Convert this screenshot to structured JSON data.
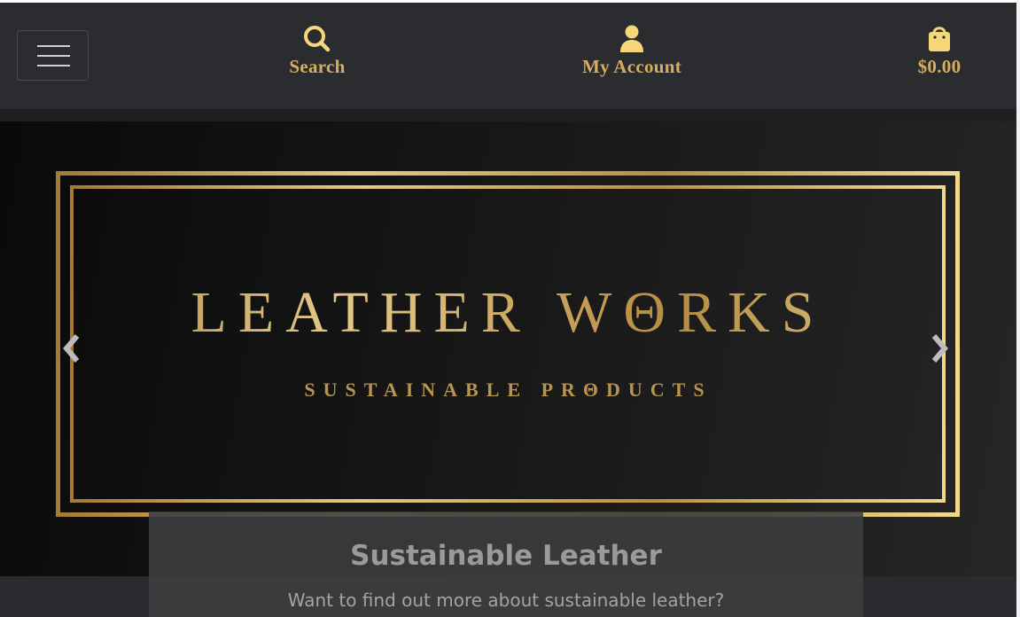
{
  "header": {
    "menu_icon": "hamburger-icon",
    "nav": [
      {
        "label": "Search",
        "icon": "search-icon"
      },
      {
        "label": "My Account",
        "icon": "user-icon"
      },
      {
        "label": "$0.00",
        "icon": "shopping-bag-icon"
      }
    ],
    "accent_color": "#d9ad5f",
    "icon_color": "#f5d77a"
  },
  "hero": {
    "title": "LEATHER WΘRKS",
    "subtitle": "SUSTAINABLE PRΘDUCTS",
    "prev_icon": "chevron-left-icon",
    "next_icon": "chevron-right-icon",
    "caption": {
      "title": "Sustainable Leather",
      "text": "Want to find out more about sustainable leather?"
    }
  }
}
